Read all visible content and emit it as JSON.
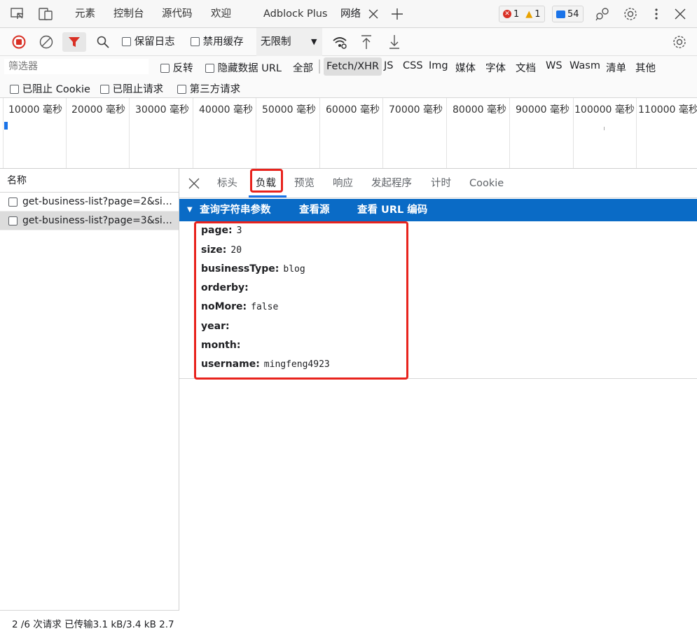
{
  "topbar": {
    "tabs": [
      "元素",
      "控制台",
      "源代码",
      "欢迎",
      "Adblock Plus",
      "网络"
    ],
    "errors": "1",
    "warnings": "1",
    "messages": "54"
  },
  "toolbar": {
    "preserve_log": "保留日志",
    "disable_cache": "禁用缓存",
    "throttling": "无限制"
  },
  "filterbar": {
    "placeholder": "筛选器",
    "invert": "反转",
    "hide_data_urls": "隐藏数据 URL",
    "types": [
      "全部",
      "Fetch/XHR",
      "JS",
      "CSS",
      "Img",
      "媒体",
      "字体",
      "文档",
      "WS",
      "Wasm",
      "清单",
      "其他"
    ],
    "blocked_cookies": "已阻止 Cookie",
    "blocked_requests": "已阻止请求",
    "third_party": "第三方请求"
  },
  "timeline": {
    "ticks": [
      "10000 毫秒",
      "20000 毫秒",
      "30000 毫秒",
      "40000 毫秒",
      "50000 毫秒",
      "60000 毫秒",
      "70000 毫秒",
      "80000 毫秒",
      "90000 毫秒",
      "100000 毫秒",
      "110000 毫秒"
    ]
  },
  "requests": {
    "header": "名称",
    "items": [
      "get-business-list?page=2&size...",
      "get-business-list?page=3&size..."
    ],
    "status": "2 /6 次请求  已传输3.1 kB/3.4 kB  2.7"
  },
  "detail": {
    "tabs": [
      "标头",
      "负载",
      "预览",
      "响应",
      "发起程序",
      "计时",
      "Cookie"
    ],
    "section_title": "查询字符串参数",
    "view_source": "查看源",
    "view_url_encoded": "查看 URL 编码",
    "params": [
      {
        "key": "page:",
        "value": "3"
      },
      {
        "key": "size:",
        "value": "20"
      },
      {
        "key": "businessType:",
        "value": "blog"
      },
      {
        "key": "orderby:",
        "value": ""
      },
      {
        "key": "noMore:",
        "value": "false"
      },
      {
        "key": "year:",
        "value": ""
      },
      {
        "key": "month:",
        "value": ""
      },
      {
        "key": "username:",
        "value": "mingfeng4923"
      }
    ]
  },
  "colors": {
    "accent": "#0a6bc6",
    "highlight": "#e8231d",
    "record": "#d93025"
  }
}
